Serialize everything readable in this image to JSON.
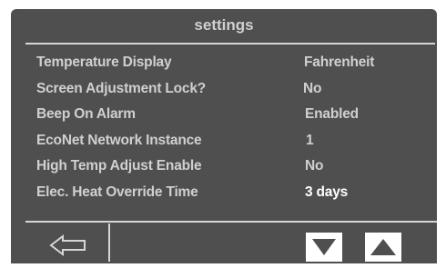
{
  "header": {
    "title": "settings"
  },
  "settings": {
    "rows": [
      {
        "label": "Temperature Display",
        "value": "Fahrenheit"
      },
      {
        "label": "Screen Adjustment Lock?",
        "value": "No"
      },
      {
        "label": "Beep On Alarm",
        "value": "Enabled"
      },
      {
        "label": "EcoNet Network Instance",
        "value": "1"
      },
      {
        "label": "High Temp Adjust Enable",
        "value": "No"
      },
      {
        "label": "Elec. Heat Override Time",
        "value": "3 days",
        "highlighted": true
      }
    ]
  },
  "footer": {
    "back_icon": "left-arrow-outline-icon",
    "down_icon": "triangle-down-icon",
    "up_icon": "triangle-up-icon"
  },
  "colors": {
    "panel": "#4f4f4f",
    "text": "#d0d0d0",
    "highlight_text": "#ffffff",
    "button": "#ffffff"
  }
}
